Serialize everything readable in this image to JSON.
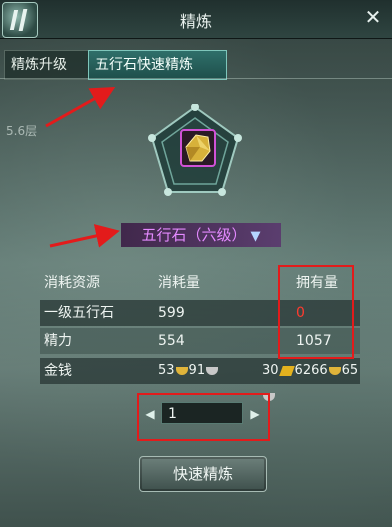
{
  "window": {
    "title": "精炼",
    "close_glyph": "✕",
    "logo_icon": "game-logo-icon"
  },
  "tabs": [
    {
      "label": "精炼升级",
      "active": false
    },
    {
      "label": "五行石快速精炼",
      "active": true
    }
  ],
  "map": {
    "label": "5.6层"
  },
  "element": {
    "name": "五行石（六级）",
    "dropdown_glyph": "▼"
  },
  "table": {
    "headers": [
      "消耗资源",
      "消耗量",
      "拥有量"
    ],
    "rows": [
      {
        "resource": "一级五行石",
        "cost": "599",
        "owned": "0",
        "owned_color": "#ff3b2f"
      },
      {
        "resource": "精力",
        "cost": "554",
        "owned": "1057"
      }
    ],
    "money": {
      "label": "金钱",
      "cost_gold": "53",
      "cost_silver": "91",
      "owned_jiaozi": "30",
      "owned_gold": "6266",
      "owned_silver": "65"
    }
  },
  "stepper": {
    "value": "1",
    "left_glyph": "◀",
    "right_glyph": "▶"
  },
  "action_button": {
    "label": "快速精炼"
  },
  "colors": {
    "highlight": "#e31b1b",
    "element_name": "#e48aff",
    "warning_value": "#ff3b2f"
  }
}
